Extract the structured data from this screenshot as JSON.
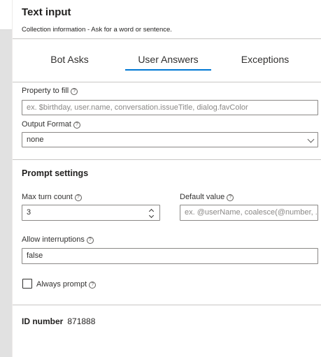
{
  "header": {
    "title": "Text input",
    "subtitle": "Collection information - Ask for a word or sentence."
  },
  "tabs": [
    {
      "label": "Bot Asks",
      "active": false
    },
    {
      "label": "User Answers",
      "active": true
    },
    {
      "label": "Exceptions",
      "active": false
    }
  ],
  "property": {
    "label": "Property to fill",
    "placeholder": "ex. $birthday, user.name, conversation.issueTitle, dialog.favColor",
    "value": ""
  },
  "output_format": {
    "label": "Output Format",
    "value": "none"
  },
  "prompt_settings": {
    "title": "Prompt settings",
    "max_turn": {
      "label": "Max turn count",
      "value": "3"
    },
    "default_value": {
      "label": "Default value",
      "placeholder": "ex. @userName, coalesce(@number, ..."
    },
    "allow_interruptions": {
      "label": "Allow interruptions",
      "value": "false"
    },
    "always_prompt": {
      "label": "Always prompt",
      "checked": false
    }
  },
  "id": {
    "label": "ID number",
    "value": "871888"
  },
  "colors": {
    "accent": "#0078d4",
    "sidebar": "#e1e1e1"
  },
  "icons": {
    "help": "help-circle-icon",
    "dropdown": "chevron-down-icon",
    "spinner": "spin-button-icon"
  }
}
